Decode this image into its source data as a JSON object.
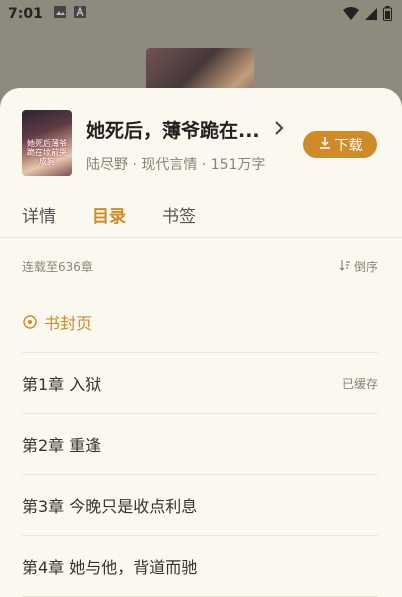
{
  "status": {
    "time": "7:01"
  },
  "book": {
    "title": "她死后，薄爷跪在...",
    "meta": "陆尽野 · 现代言情 · 151万字",
    "cover_text": "她死后薄爷跪在坟前哭成狗",
    "download_label": "下载"
  },
  "tabs": [
    {
      "label": "详情"
    },
    {
      "label": "目录"
    },
    {
      "label": "书签"
    }
  ],
  "catalog": {
    "count": "连载至636章",
    "sort_label": "倒序",
    "cover_page": "书封页",
    "chapters": [
      {
        "title": "第1章 入狱",
        "status": "已缓存"
      },
      {
        "title": "第2章 重逢",
        "status": ""
      },
      {
        "title": "第3章 今晚只是收点利息",
        "status": ""
      },
      {
        "title": "第4章 她与他，背道而驰",
        "status": ""
      }
    ]
  },
  "colors": {
    "accent": "#cf8a2a",
    "sheet": "#fbf8ef"
  }
}
